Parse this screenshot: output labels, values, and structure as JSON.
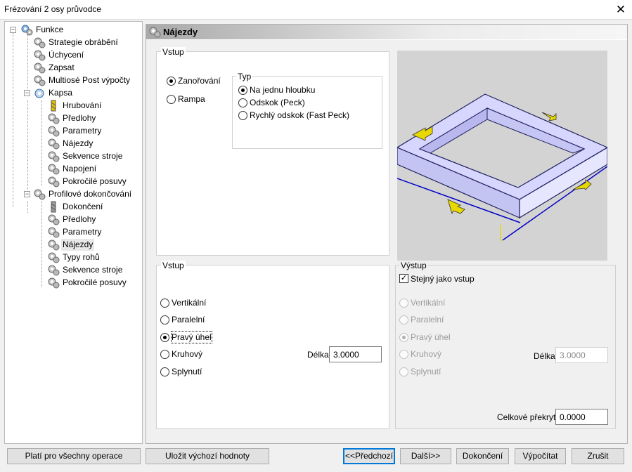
{
  "window": {
    "title": "Frézování 2 osy průvodce",
    "close_glyph": "✕"
  },
  "tree": {
    "root": "Funkce",
    "items": [
      "Strategie obrábění",
      "Úchycení",
      "Zapsat",
      "Multiosé Post výpočty",
      "Kapsa",
      "Hrubování",
      "Předlohy",
      "Parametry",
      "Nájezdy",
      "Sekvence stroje",
      "Napojení",
      "Pokročilé posuvy",
      "Profilové dokončování",
      "Dokončení",
      "Předlohy",
      "Parametry",
      "Nájezdy",
      "Typy rohů",
      "Sekvence stroje",
      "Pokročilé posuvy"
    ],
    "toggle_minus": "−",
    "selected": "Nájezdy"
  },
  "header": {
    "title": "Nájezdy"
  },
  "vstup_top": {
    "caption": "Vstup",
    "options": [
      "Zanořování",
      "Rampa"
    ],
    "selected": "Zanořování",
    "typ": {
      "caption": "Typ",
      "options": [
        "Na jednu hloubku",
        "Odskok (Peck)",
        "Rychlý odskok (Fast Peck)"
      ],
      "selected": "Na jednu hloubku"
    }
  },
  "vstup_bottom": {
    "caption": "Vstup",
    "options": [
      "Vertikální",
      "Paralelní",
      "Pravý úhel",
      "Kruhový",
      "Splynutí"
    ],
    "selected": "Pravý úhel",
    "delka_label": "Délka",
    "delka_value": "3.0000"
  },
  "vystup": {
    "caption": "Výstup",
    "same_as_input_label": "Stejný jako vstup",
    "same_as_input_checked": true,
    "check_glyph": "✓",
    "options": [
      "Vertikální",
      "Paralelní",
      "Pravý úhel",
      "Kruhový",
      "Splynutí"
    ],
    "selected": "Pravý úhel",
    "delka_label": "Délka",
    "delka_value": "3.0000",
    "overlap_label": "Celkové překrytí",
    "overlap_value": "0.0000"
  },
  "buttons": {
    "apply_all": "Platí pro všechny operace",
    "save_defaults": "Uložit výchozí hodnoty",
    "prev": "<<Předchozí",
    "next": "Další>>",
    "finish": "Dokončení",
    "compute": "Výpočítat",
    "cancel": "Zrušit"
  },
  "colors": {
    "default_button_border": "#0078d7",
    "frame_top": "#d6d6ff",
    "arrow": "#e8d800",
    "axis": "#0000c8"
  }
}
